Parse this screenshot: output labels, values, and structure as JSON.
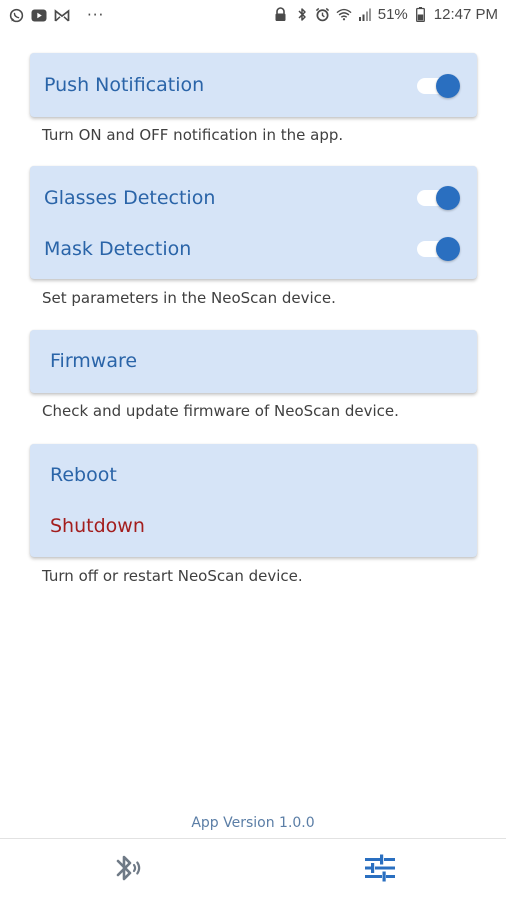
{
  "status_bar": {
    "battery": "51%",
    "time": "12:47 PM",
    "left_icons": [
      "whatsapp-icon",
      "youtube-icon",
      "gmail-icon"
    ],
    "more": "···"
  },
  "cards": {
    "notification": {
      "push_label": "Push Notification",
      "push_enabled": true,
      "caption": "Turn ON and OFF notification in the app."
    },
    "detection": {
      "glasses_label": "Glasses Detection",
      "glasses_enabled": true,
      "mask_label": "Mask Detection",
      "mask_enabled": true,
      "caption": "Set parameters in the NeoScan device."
    },
    "firmware": {
      "label": "Firmware",
      "caption": "Check and update firmware of NeoScan device."
    },
    "power": {
      "reboot_label": "Reboot",
      "shutdown_label": "Shutdown",
      "caption": "Turn off or restart NeoScan device."
    }
  },
  "app_version": "App Version 1.0.0",
  "bottom_nav": {
    "items": [
      {
        "icon": "bluetooth-icon",
        "active": false
      },
      {
        "icon": "settings-sliders-icon",
        "active": true
      }
    ]
  },
  "colors": {
    "card_bg": "#d6e4f7",
    "label_blue": "#2a64a8",
    "danger_red": "#a31d1d",
    "toggle_blue": "#2a6fc0"
  }
}
